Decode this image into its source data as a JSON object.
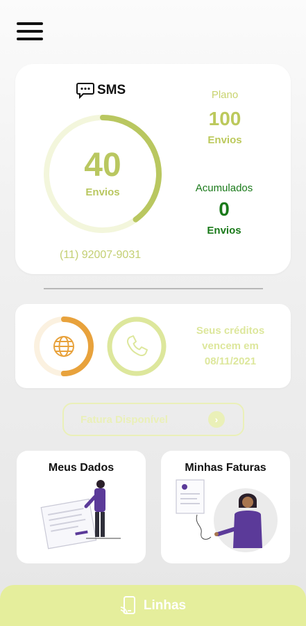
{
  "header": {
    "menu_icon": "hamburger-menu-icon"
  },
  "sms_card": {
    "title": "SMS",
    "icon": "sms-chat-icon",
    "remaining": "40",
    "remaining_unit": "Envios",
    "progress_fraction": 0.4,
    "phone_number": "(11) 92007-9031",
    "plan_label": "Plano",
    "plan_value": "100",
    "plan_unit": "Envios",
    "accumulated_label": "Acumulados",
    "accumulated_value": "0",
    "accumulated_unit": "Envios",
    "colors": {
      "accent": "#b9c760",
      "track": "#f3f6dc",
      "accumulated": "#1a7a1a"
    }
  },
  "credits_card": {
    "data_icon": "globe-icon",
    "voice_icon": "phone-icon",
    "data_progress_fraction": 0.5,
    "text_line1": "Seus créditos",
    "text_line2": "vencem em",
    "expiry_date": "08/11/2021",
    "colors": {
      "data": "#e8a23c",
      "data_track": "#fbf1e0",
      "voice": "#dde79c"
    }
  },
  "invoice_button": {
    "label": "Fatura Disponível",
    "icon": "arrow-right-circle-icon"
  },
  "tiles": {
    "my_data": {
      "title": "Meus Dados"
    },
    "my_invoices": {
      "title": "Minhas Faturas"
    }
  },
  "bottom_bar": {
    "label": "Linhas",
    "icon": "mobile-lines-icon"
  }
}
